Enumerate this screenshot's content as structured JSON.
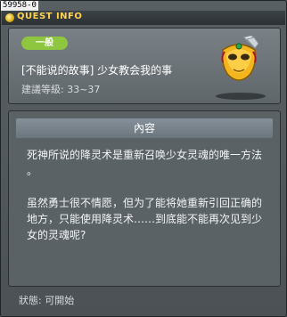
{
  "window": {
    "id_tag": "59958-0",
    "title": "QUEST INFO"
  },
  "quest": {
    "category": "一般",
    "name": "[不能说的故事] 少女教会我的事",
    "level": "建議等級: 33~37",
    "icon": "theater-mask-icon"
  },
  "description": {
    "header": "內容",
    "text": "死神所说的降灵术是重新召唤少女灵魂的唯一方法\n。\n\n虽然勇士很不情愿，但为了能将她重新引回正确的\n地方，只能使用降灵术……到底能不能再次见到少\n女的灵魂呢?"
  },
  "status": {
    "text": "狀態: 可開始"
  },
  "colors": {
    "title_text": "#ffd24a",
    "badge": "#8ec63f"
  }
}
